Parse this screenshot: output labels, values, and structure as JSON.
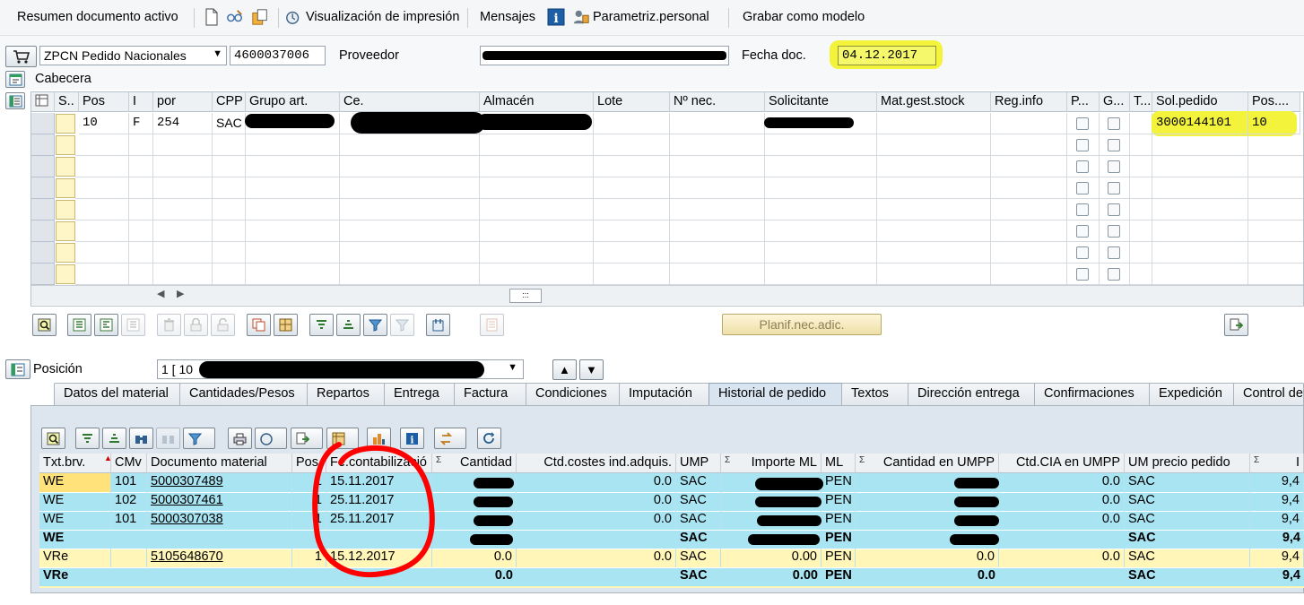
{
  "toolbar": {
    "items": [
      "Resumen documento activo",
      "Visualización de impresión",
      "Mensajes",
      "Parametriz.personal",
      "Grabar como modelo"
    ]
  },
  "header": {
    "doc_type": "ZPCN Pedido Nacionales",
    "doc_number": "4600037006",
    "vendor_label": "Proveedor",
    "doc_date_label": "Fecha doc.",
    "doc_date": "04.12.2017",
    "cabecera_label": "Cabecera"
  },
  "items_grid": {
    "columns": [
      "S..",
      "Pos",
      "I",
      "por",
      "CPP",
      "Grupo art.",
      "Ce.",
      "Almacén",
      "Lote",
      "Nº nec.",
      "Solicitante",
      "Mat.gest.stock",
      "Reg.info",
      "P...",
      "G...",
      "T...",
      "Sol.pedido",
      "Pos...."
    ],
    "row": {
      "pos": "10",
      "i": "F",
      "por": "254",
      "cpp": "SAC",
      "sol_pedido": "3000144101",
      "pos_sol": "10"
    }
  },
  "planif_button": "Planif.nec.adic.",
  "position": {
    "label": "Posición",
    "value": "1 [ 10"
  },
  "tabs": [
    "Datos del material",
    "Cantidades/Pesos",
    "Repartos",
    "Entrega",
    "Factura",
    "Condiciones",
    "Imputación",
    "Historial de pedido",
    "Textos",
    "Dirección entrega",
    "Confirmaciones",
    "Expedición",
    "Control de"
  ],
  "active_tab": "Historial de pedido",
  "history": {
    "columns": [
      "Txt.brv.",
      "CMv",
      "Documento material",
      "Pos",
      "Fe.contabilizació",
      "Cantidad",
      "Ctd.costes ind.adquis.",
      "UMP",
      "Importe ML",
      "ML",
      "Cantidad en UMPP",
      "Ctd.CIA en UMPP",
      "UM precio pedido",
      "I"
    ],
    "rows": [
      {
        "txt": "WE",
        "cmv": "101",
        "doc": "5000307489",
        "pos": "1",
        "date": "15.11.2017",
        "ctdcost": "0.0",
        "ump": "SAC",
        "ml": "PEN",
        "ctdcia": "0.0",
        "umpp": "SAC",
        "last": "9,4"
      },
      {
        "txt": "WE",
        "cmv": "102",
        "doc": "5000307461",
        "pos": "1",
        "date": "25.11.2017",
        "ctdcost": "0.0",
        "ump": "SAC",
        "ml": "PEN",
        "ctdcia": "0.0",
        "umpp": "SAC",
        "last": "9,4"
      },
      {
        "txt": "WE",
        "cmv": "101",
        "doc": "5000307038",
        "pos": "1",
        "date": "25.11.2017",
        "ctdcost": "0.0",
        "ump": "SAC",
        "ml": "PEN",
        "ctdcia": "0.0",
        "umpp": "SAC",
        "last": "9,4"
      },
      {
        "txt": "VRe",
        "cmv": "",
        "doc": "5105648670",
        "pos": "1",
        "date": "15.12.2017",
        "cantidad": "0.0",
        "ctdcost": "0.0",
        "ump": "SAC",
        "importe": "0.00",
        "ml": "PEN",
        "cant_umpp": "0.0",
        "ctdcia": "0.0",
        "umpp": "SAC",
        "last": "9,4"
      }
    ],
    "totals": [
      {
        "txt": "WE",
        "ump": "SAC",
        "ml": "PEN",
        "umpp": "SAC",
        "last": "9,4"
      },
      {
        "txt": "VRe",
        "cantidad": "0.0",
        "ump": "SAC",
        "importe": "0.00",
        "ml": "PEN",
        "cant_umpp": "0.0",
        "umpp": "SAC",
        "last": "9,4"
      }
    ]
  }
}
